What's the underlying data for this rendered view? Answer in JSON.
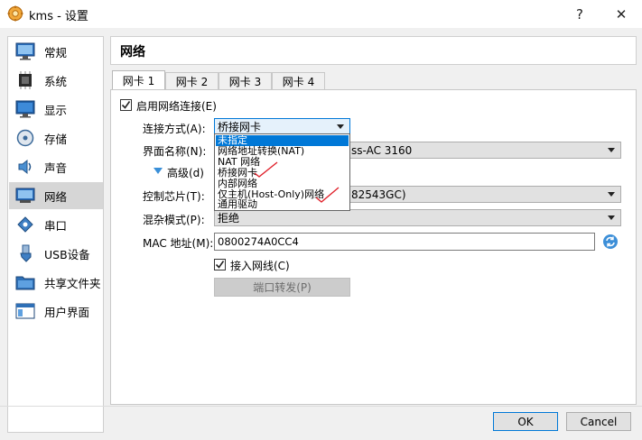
{
  "window": {
    "title": "kms - 设置",
    "help_label": "?",
    "close_label": "✕"
  },
  "sidebar": {
    "items": [
      {
        "label": "常规",
        "icon": "general-icon"
      },
      {
        "label": "系统",
        "icon": "system-icon"
      },
      {
        "label": "显示",
        "icon": "display-icon"
      },
      {
        "label": "存储",
        "icon": "storage-icon"
      },
      {
        "label": "声音",
        "icon": "audio-icon"
      },
      {
        "label": "网络",
        "icon": "network-icon",
        "active": true
      },
      {
        "label": "串口",
        "icon": "serial-port-icon"
      },
      {
        "label": "USB设备",
        "icon": "usb-icon"
      },
      {
        "label": "共享文件夹",
        "icon": "shared-folder-icon"
      },
      {
        "label": "用户界面",
        "icon": "user-interface-icon"
      }
    ]
  },
  "page": {
    "title": "网络"
  },
  "tabs": [
    {
      "label": "网卡 1",
      "active": true
    },
    {
      "label": "网卡 2"
    },
    {
      "label": "网卡 3"
    },
    {
      "label": "网卡 4"
    }
  ],
  "form": {
    "enable_label": "启用网络连接(E)",
    "attached_label": "连接方式(A):",
    "attached_value": "桥接网卡",
    "name_label": "界面名称(N):",
    "name_value_suffix": "ss-AC 3160",
    "advanced_label": "高级(d)",
    "adapter_label": "控制芯片(T):",
    "adapter_value_suffix": "82543GC)",
    "promisc_label": "混杂模式(P):",
    "promisc_value": "拒绝",
    "mac_label": "MAC 地址(M):",
    "mac_value": "0800274A0CC4",
    "cable_label": "接入网线(C)",
    "port_forward_label": "端口转发(P)"
  },
  "dropdown": {
    "options": [
      "未指定",
      "网络地址转换(NAT)",
      "NAT 网络",
      "桥接网卡",
      "内部网络",
      "仅主机(Host-Only)网络",
      "通用驱动"
    ],
    "selected_index": 0
  },
  "footer": {
    "ok_label": "OK",
    "cancel_label": "Cancel"
  },
  "colors": {
    "accent": "#0078d7",
    "annotation": "#e0202a"
  }
}
